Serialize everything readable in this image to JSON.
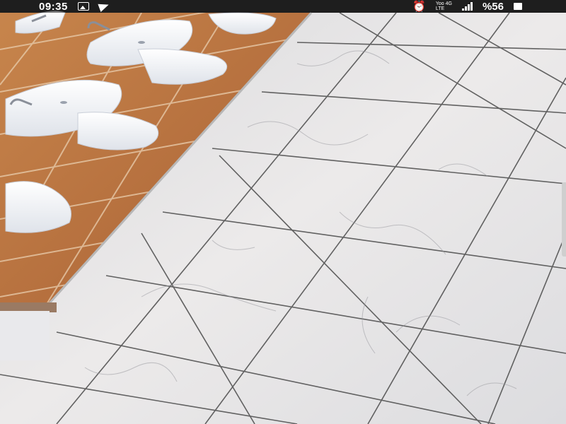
{
  "status_bar": {
    "time": "09:35",
    "network_top": "Yoo 4G",
    "network_bottom": "LTE",
    "battery": "%56",
    "icons": [
      "image-icon",
      "send-icon",
      "alarm-icon",
      "signal-icon",
      "battery-icon"
    ]
  },
  "scene": {
    "wall_tile_color": "#c98a52",
    "grout_color": "#e6c9a8",
    "floor_base_color": "#e8e6e6",
    "floor_joint_color": "#4a4a4a",
    "fixture_color": "#f7f8fa"
  }
}
